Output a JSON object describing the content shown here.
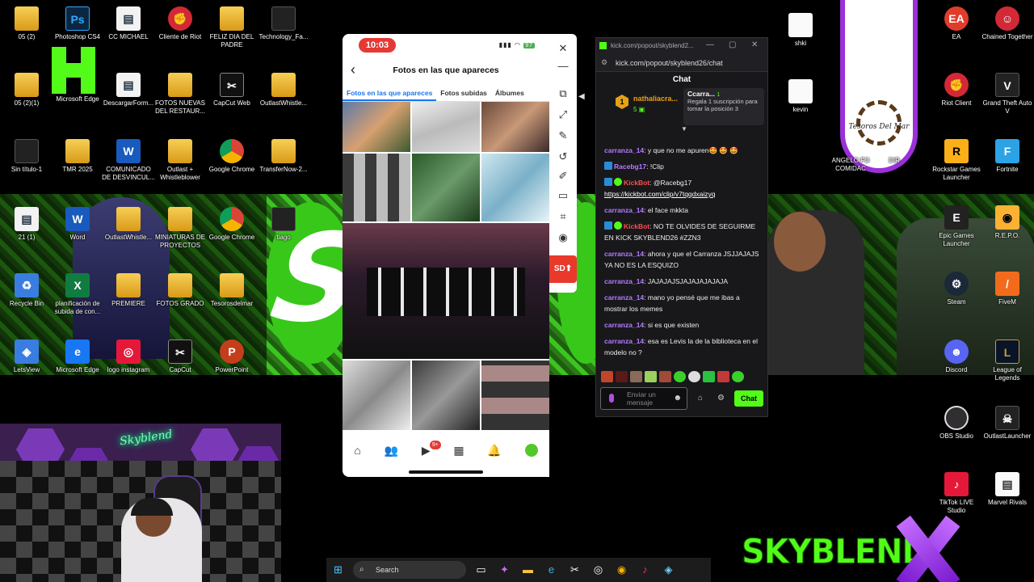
{
  "desktop": {
    "icons": [
      {
        "label": "05 (2)",
        "glyph": "folder"
      },
      {
        "label": "Photoshop CS4",
        "glyph": "Ps"
      },
      {
        "label": "CC MICHAEL",
        "glyph": "doc"
      },
      {
        "label": "Cliente de Riot",
        "glyph": "riot"
      },
      {
        "label": "FELIZ DIA DEL PADRE",
        "glyph": "folder"
      },
      {
        "label": "Technology_Fa...",
        "glyph": "dark"
      },
      {
        "label": "05 (2)(1)",
        "glyph": "folder"
      },
      {
        "label": "Microsoft Edge",
        "glyph": "edge"
      },
      {
        "label": "DescargarForm...",
        "glyph": "doc"
      },
      {
        "label": "FOTOS NUEVAS DEL RESTAUR...",
        "glyph": "folder"
      },
      {
        "label": "CapCut Web",
        "glyph": "capcut"
      },
      {
        "label": "OutlastWhistle...",
        "glyph": "folder"
      },
      {
        "label": "Sin título-1",
        "glyph": "dark"
      },
      {
        "label": "TMR 2025",
        "glyph": "folder"
      },
      {
        "label": "COMUNICADO DE DESVINCUL...",
        "glyph": "word"
      },
      {
        "label": "Outlast + Whistleblower",
        "glyph": "folder"
      },
      {
        "label": "Google Chrome",
        "glyph": "chrome"
      },
      {
        "label": "TransferNow-2...",
        "glyph": "folder"
      },
      {
        "label": "21 (1)",
        "glyph": "doc"
      },
      {
        "label": "Word",
        "glyph": "word"
      },
      {
        "label": "OutlastWhistle...",
        "glyph": "folder"
      },
      {
        "label": "MINIATURAS DE PROYECTOS",
        "glyph": "folder"
      },
      {
        "label": "Google Chrome",
        "glyph": "chrome"
      },
      {
        "label": "tiago",
        "glyph": "dark"
      },
      {
        "label": "Recycle Bin",
        "glyph": "recycle"
      },
      {
        "label": "planificación de subida de con...",
        "glyph": "excel"
      },
      {
        "label": "PREMIERE",
        "glyph": "folder"
      },
      {
        "label": "FOTOS GRADO",
        "glyph": "folder"
      },
      {
        "label": "Tesorosdelmar",
        "glyph": "folder"
      },
      {
        "label": "LetsView",
        "glyph": "letsview"
      },
      {
        "label": "Microsoft Edge",
        "glyph": "edge"
      },
      {
        "label": "logo instagram",
        "glyph": "instagram"
      },
      {
        "label": "CapCut",
        "glyph": "capcut"
      },
      {
        "label": "PowerPoint",
        "glyph": "pp"
      },
      {
        "label": "shki",
        "glyph": "dark"
      },
      {
        "label": "EA",
        "glyph": "ea"
      },
      {
        "label": "Chained Together",
        "glyph": "dark"
      },
      {
        "label": "kevin",
        "glyph": "dark"
      },
      {
        "label": "Riot Client",
        "glyph": "riot"
      },
      {
        "label": "Grand Theft Auto V",
        "glyph": "gta"
      },
      {
        "label": "ANGELO FO COMIDAC",
        "glyph": "dark"
      },
      {
        "label": "DIR",
        "glyph": "dark"
      },
      {
        "label": "Rockstar Games Launcher",
        "glyph": "rockstar"
      },
      {
        "label": "Fortnite",
        "glyph": "fortnite"
      },
      {
        "label": "Epic Games Launcher",
        "glyph": "epic"
      },
      {
        "label": "R.E.P.O.",
        "glyph": "redo"
      },
      {
        "label": "Steam",
        "glyph": "steam"
      },
      {
        "label": "FiveM",
        "glyph": "fivem"
      },
      {
        "label": "Discord",
        "glyph": "discord"
      },
      {
        "label": "League of Legends",
        "glyph": "lol"
      },
      {
        "label": "OBS Studio",
        "glyph": "obs"
      },
      {
        "label": "OutlastLauncher",
        "glyph": "dark"
      },
      {
        "label": "TikTok LIVE Studio",
        "glyph": "tiktok"
      },
      {
        "label": "Marvel Rivals",
        "glyph": "white"
      }
    ],
    "tesoros_label": "Tesoros Del Mar",
    "wallpaper_text": "SKYBLEND",
    "skyblend_logo": "SKYBLEND",
    "skyblend_x": "X"
  },
  "phone": {
    "time": "10:03",
    "battery": "97",
    "title": "Fotos en las que apareces",
    "tabs": [
      "Fotos en las que apareces",
      "Fotos subidas",
      "Álbumes"
    ],
    "nav_badge": "9+"
  },
  "phone_tools": {
    "sd_label": "SD"
  },
  "chat_window": {
    "tab_title": "kick.com/popout/skyblend2...",
    "address": "kick.com/popout/skyblend26/chat",
    "header": "Chat",
    "pinned": {
      "rank": "1",
      "user": "nathaliacra...",
      "count": "5",
      "card_user": "Ccarra...",
      "card_count": "1",
      "card_text": "Regala 1 suscripción para tomar la posición 3"
    },
    "messages": [
      {
        "user": "carranza_14",
        "color": "#b57bff",
        "text": ": y que no me apuren🤩 🤩 🤩",
        "bot": false
      },
      {
        "user": "Racebg17",
        "color": "#b57bff",
        "text": ": !Clip",
        "bot": false,
        "botIcon": true
      },
      {
        "user": "KickBot",
        "color": "#ff4d4d",
        "text": ": @Racebg17",
        "bot": true,
        "link": "https://kickbot.com/clip/v7tqqdxaizyq"
      },
      {
        "user": "carranza_14",
        "color": "#b57bff",
        "text": ": el face mkkta",
        "bot": false
      },
      {
        "user": "KickBot",
        "color": "#ff4d4d",
        "text": ": NO TE OLVIDES DE SEGUIRME EN KICK SKYBLEND26 #ZZN3",
        "bot": true
      },
      {
        "user": "carranza_14",
        "color": "#b57bff",
        "text": ": ahora y que el Carranza JSJJAJAJS YA NO ES LA ESQUIZO",
        "bot": false
      },
      {
        "user": "carranza_14",
        "color": "#b57bff",
        "text": ": JAJAJAJSJAJAJAJAJAJA",
        "bot": false
      },
      {
        "user": "carranza_14",
        "color": "#b57bff",
        "text": ": mano yo pensé que me ibas a mostrar los memes",
        "bot": false
      },
      {
        "user": "carranza_14",
        "color": "#b57bff",
        "text": ": si es que existen",
        "bot": false
      },
      {
        "user": "carranza_14",
        "color": "#b57bff",
        "text": ": esa es Levis la de la biblioteca en el modelo no ?",
        "bot": false
      }
    ],
    "input_placeholder": "Enviar un mensaje",
    "send_label": "Chat"
  },
  "taskbar": {
    "search_label": "Search"
  }
}
